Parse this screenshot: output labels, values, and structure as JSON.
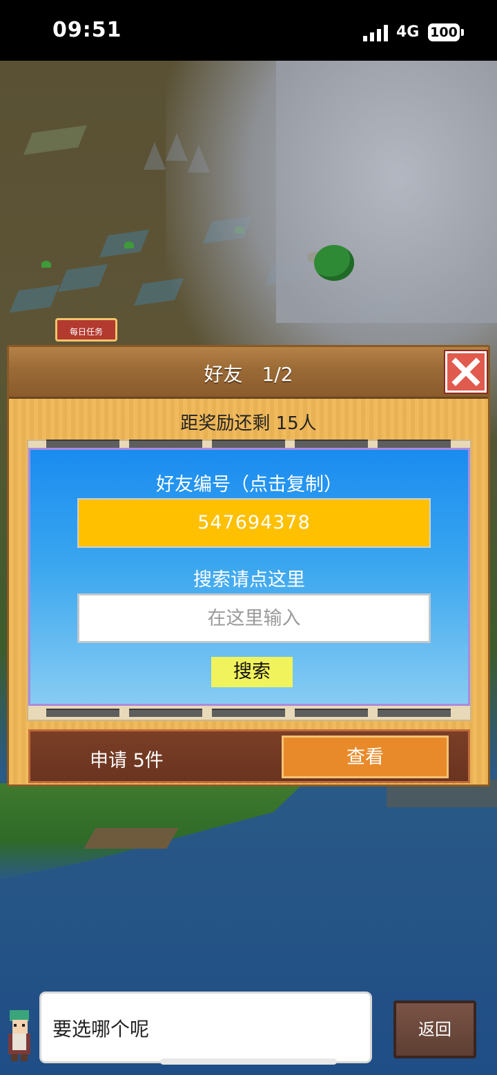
{
  "status_bar": {
    "time": "09:51",
    "network": "4G",
    "battery": "100"
  },
  "game": {
    "daily_task_label": "每日任务"
  },
  "dialog": {
    "title": "好友　1/2",
    "reward_text": "距奖励还剩 15人",
    "friend_id_label": "好友编号（点击复制）",
    "friend_id": "547694378",
    "search_label": "搜索请点这里",
    "search_placeholder": "在这里输入",
    "search_button": "搜索",
    "request_text": "申请 5件",
    "view_button": "查看"
  },
  "bottom": {
    "speech_text": "要选哪个呢",
    "back_button": "返回"
  },
  "colors": {
    "dialog_bg": "#efb756",
    "panel_blue": "#1a8cf0",
    "friend_id_bg": "#ffc000",
    "search_button_bg": "#f1f35c",
    "view_button_bg": "#e88a2a",
    "close_button_bg": "#e15a4e"
  },
  "icons": [
    "signal-icon",
    "close-icon",
    "arrow-left-icon",
    "arrow-right-icon",
    "character-avatar"
  ]
}
